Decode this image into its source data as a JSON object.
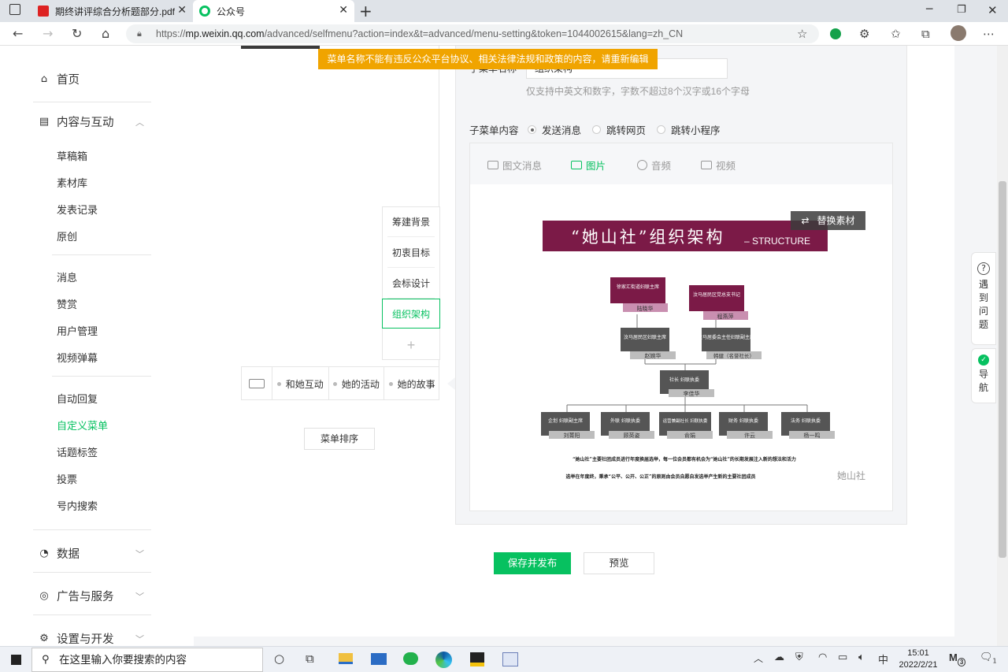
{
  "browser": {
    "tabs": [
      {
        "title": "期终讲评综合分析题部分.pdf",
        "icon": "pdf-icon"
      },
      {
        "title": "公众号",
        "icon": "wechat-mp-icon"
      }
    ],
    "url_prefix": "https://",
    "url_domain": "mp.weixin.qq.com",
    "url_path": "/advanced/selfmenu?action=index&t=advanced/menu-setting&token=1044002615&lang=zh_CN",
    "window_controls": [
      "minimize",
      "restore",
      "close"
    ]
  },
  "sidebar": {
    "home": "首页",
    "content_section": "内容与互动",
    "content_items": [
      "草稿箱",
      "素材库",
      "发表记录",
      "原创"
    ],
    "interaction_items": [
      "消息",
      "赞赏",
      "用户管理",
      "视频弹幕"
    ],
    "menu_items": [
      "自动回复",
      "自定义菜单",
      "话题标签",
      "投票",
      "号内搜索"
    ],
    "active_item": "自定义菜单",
    "data_section": "数据",
    "ads_section": "广告与服务",
    "settings_section": "设置与开发"
  },
  "warning_banner": "菜单名称不能有违反公众平台协议、相关法律法规和政策的内容，请重新编辑",
  "phone_preview": {
    "menu_bar": [
      "和她互动",
      "她的活动",
      "她的故事"
    ],
    "submenu": [
      "筹建背景",
      "初衷目标",
      "会标设计",
      "组织架构"
    ],
    "selected_submenu": "组织架构",
    "add_symbol": "+",
    "sort_button": "菜单排序"
  },
  "editor": {
    "name_label": "子菜单名称",
    "name_value": "组织架构",
    "name_hint": "仅支持中英文和数字，字数不超过8个汉字或16个字母",
    "content_label": "子菜单内容",
    "content_options": [
      "发送消息",
      "跳转网页",
      "跳转小程序"
    ],
    "selected_option": "发送消息",
    "message_types": [
      "图文消息",
      "图片",
      "音频",
      "视频"
    ],
    "selected_type": "图片",
    "replace_button": "替换素材"
  },
  "org_chart_image": {
    "title": "“她山社”组织架构",
    "title_suffix": "– STRUCTURE",
    "top_nodes": [
      {
        "role": "徐家汇街道妇联主席",
        "name": "陆晓华"
      },
      {
        "role": "汶马居民区党总支书记",
        "name": "程燕萍"
      }
    ],
    "mid_nodes": [
      {
        "role": "汶马居民区妇联主席",
        "name": "赵婉华"
      },
      {
        "role": "汶马居委会主任妇联副主席",
        "name": "韩健（名誉社长）"
      }
    ],
    "center_node": {
      "role": "社长 妇联执委",
      "name": "李佳华"
    },
    "bottom_nodes": [
      {
        "role": "企划 妇联副主席",
        "name": "刘菁阳"
      },
      {
        "role": "外联 妇联执委",
        "name": "顾英姿"
      },
      {
        "role": "运营兼副社长 妇联执委",
        "name": "俞娟"
      },
      {
        "role": "财务 妇联执委",
        "name": "许云"
      },
      {
        "role": "法务 妇联执委",
        "name": "杨一鸣"
      }
    ],
    "caption_line1": "“她山社”主要社团成员进行年度换届选举，每一位会员都有机会为“她山社”的长期发展注入新的想法和活力",
    "caption_line2": "选举在年度终，秉承“公平、公开、公正”的原则由会员自愿自发选举产生新的主要社团成员",
    "watermark": "她山社"
  },
  "helper_widgets": {
    "question": "遇到问题",
    "nav": "导航"
  },
  "actions": {
    "save": "保存并发布",
    "preview": "预览"
  },
  "taskbar": {
    "search_placeholder": "在这里输入你要搜索的内容",
    "time": "15:01",
    "date": "2022/2/21",
    "ime": "中",
    "notification_count": "1",
    "mail_count": "3"
  },
  "colors": {
    "accent": "#07c160",
    "warning": "#f0a400",
    "org_title": "#7b1a47",
    "node_dark": "#555555"
  }
}
